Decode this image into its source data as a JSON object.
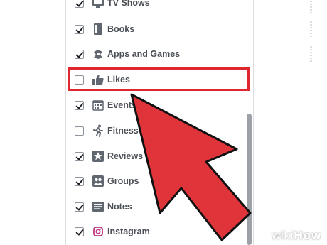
{
  "list": {
    "items": [
      {
        "label": "TV Shows",
        "checked": true,
        "icon": "tv-icon"
      },
      {
        "label": "Books",
        "checked": true,
        "icon": "book-icon"
      },
      {
        "label": "Apps and Games",
        "checked": true,
        "icon": "gamepad-icon"
      },
      {
        "label": "Likes",
        "checked": false,
        "icon": "thumbs-up-icon"
      },
      {
        "label": "Events",
        "checked": true,
        "icon": "calendar-icon"
      },
      {
        "label": "Fitness",
        "checked": false,
        "icon": "runner-icon"
      },
      {
        "label": "Reviews",
        "checked": true,
        "icon": "star-icon"
      },
      {
        "label": "Groups",
        "checked": true,
        "icon": "groups-icon"
      },
      {
        "label": "Notes",
        "checked": true,
        "icon": "notes-icon"
      },
      {
        "label": "Instagram",
        "checked": true,
        "icon": "instagram-icon"
      }
    ]
  },
  "watermark": {
    "part1": "wiki",
    "part2": "How"
  },
  "colors": {
    "highlight": "#e0262e",
    "arrow": "#e0343b",
    "label": "#4b4f56"
  }
}
